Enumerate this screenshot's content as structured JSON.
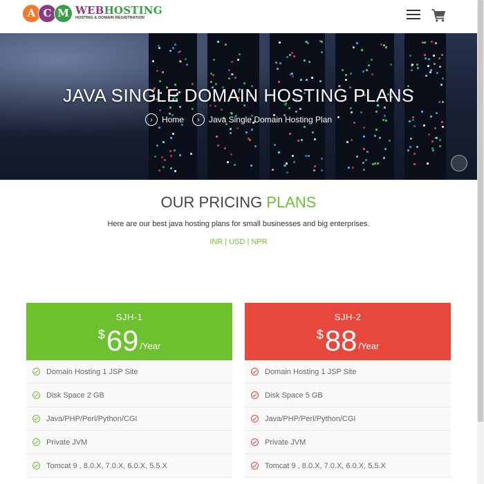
{
  "header": {
    "logo_letters": [
      "A",
      "C",
      "M"
    ],
    "logo_colors": [
      "#f0792d",
      "#8c3a87",
      "#37a047"
    ],
    "logo_main_part1": "WEB",
    "logo_main_part2": "HOSTING",
    "logo_sub": "HOSTING & DOMAIN REGISTRATION",
    "menu_icon": "hamburger-icon",
    "cart_icon": "cart-icon"
  },
  "hero": {
    "title": "JAVA SINGLE DOMAIN HOSTING PLANS",
    "breadcrumb": [
      {
        "label": "Home"
      },
      {
        "label": "Java Single Domain Hosting Plan"
      }
    ]
  },
  "pricing": {
    "title_part1": "OUR PRICING ",
    "title_part2": "PLANS",
    "subtitle": "Here are our best java hosting plans for small businesses and big enterprises.",
    "currency_inr": "INR",
    "currency_usd": "USD",
    "currency_npr": "NPR",
    "separator": " | "
  },
  "plans": [
    {
      "name": "SJH-1",
      "currency_symbol": "$",
      "price": "69",
      "period": "/Year",
      "color": "#6ec12e",
      "features": [
        "Domain Hosting 1 JSP Site",
        "Disk Space 2 GB",
        "Java/PHP/Perl/Python/CGI",
        "Private JVM",
        "Tomcat 9 , 8.0.X, 7.0.X, 6.0.X, 5.5.X"
      ]
    },
    {
      "name": "SJH-2",
      "currency_symbol": "$",
      "price": "88",
      "period": "/Year",
      "color": "#e6483b",
      "features": [
        "Domain Hosting 1 JSP Site",
        "Disk Space 5 GB",
        "Java/PHP/Perl/Python/CGI",
        "Private JVM",
        "Tomcat 9 , 8.0.X, 7.0.X, 6.0.X, 5.5.X"
      ]
    }
  ]
}
